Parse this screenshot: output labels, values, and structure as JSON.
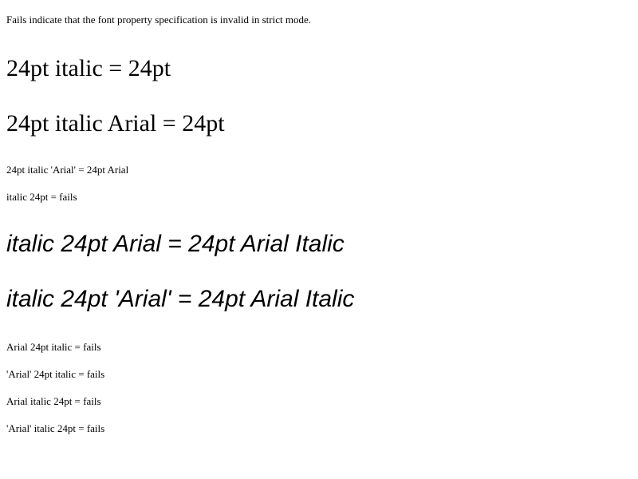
{
  "intro": "Fails indicate that the font property specification is invalid in strict mode.",
  "tests": [
    "24pt italic = 24pt",
    "24pt italic Arial = 24pt",
    "24pt italic 'Arial' = 24pt Arial",
    "italic 24pt = fails",
    "italic 24pt Arial = 24pt Arial Italic",
    "italic 24pt 'Arial' = 24pt Arial Italic",
    "Arial 24pt italic = fails",
    "'Arial' 24pt italic = fails",
    "Arial italic 24pt = fails",
    "'Arial' italic 24pt = fails"
  ]
}
